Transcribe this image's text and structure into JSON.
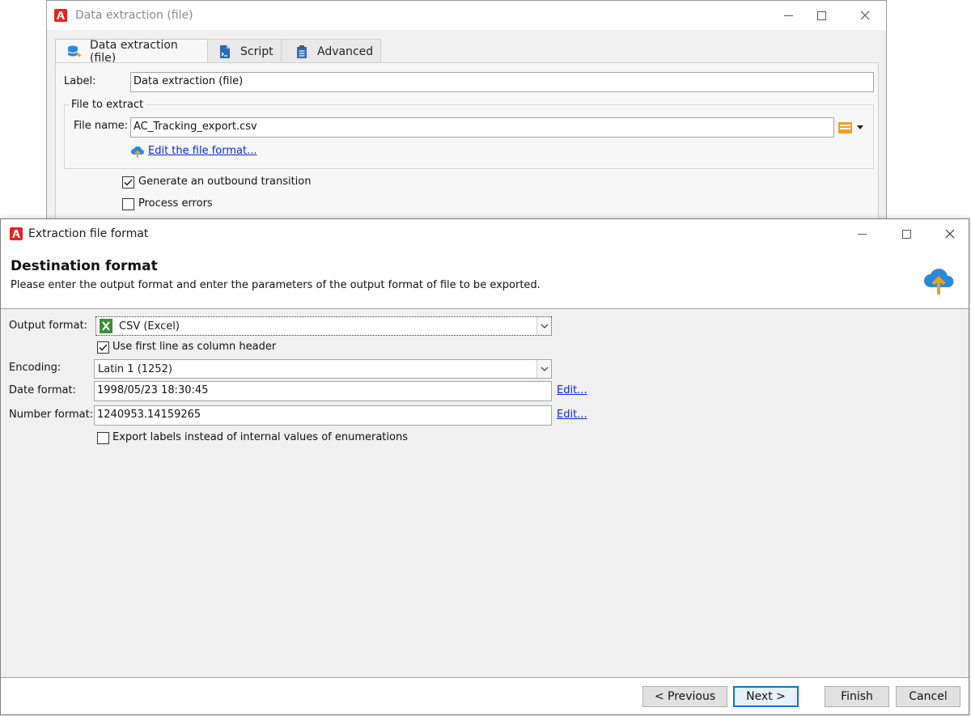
{
  "bg_window": {
    "title": "Data extraction (file)",
    "tabs": [
      {
        "label": "Data extraction (file)",
        "icon": "database-export-icon"
      },
      {
        "label": "Script",
        "icon": "script-file-icon"
      },
      {
        "label": "Advanced",
        "icon": "clipboard-settings-icon"
      }
    ],
    "label_caption": "Label:",
    "label_value": "Data extraction (file)",
    "group_title": "File to extract",
    "file_name_caption": "File name:",
    "file_name_value": "AC_Tracking_export.csv",
    "edit_format_link": "Edit the file format...",
    "generate_transition": {
      "label": "Generate an outbound transition",
      "checked": true
    },
    "process_errors": {
      "label": "Process errors",
      "checked": false
    }
  },
  "dialog": {
    "title": "Extraction file format",
    "header_title": "Destination format",
    "header_desc": "Please enter the output format and enter the parameters of the output format of file to be exported.",
    "output_format": {
      "caption": "Output format:",
      "value": "CSV (Excel)",
      "icon": "excel-icon"
    },
    "first_line_header": {
      "label": "Use first line as column header",
      "checked": true
    },
    "encoding": {
      "caption": "Encoding:",
      "value": "Latin 1 (1252)"
    },
    "date_format": {
      "caption": "Date format:",
      "value": "1998/05/23 18:30:45",
      "edit": "Edit..."
    },
    "number_format": {
      "caption": "Number format:",
      "value": "1240953.14159265",
      "edit": "Edit..."
    },
    "export_labels": {
      "label": "Export labels instead of internal values of enumerations",
      "checked": false
    },
    "buttons": {
      "previous": "< Previous",
      "next": "Next >",
      "finish": "Finish",
      "cancel": "Cancel"
    }
  },
  "colors": {
    "adobe_red": "#e8231f",
    "link_blue": "#0a28d6",
    "cloud_blue": "#2a8ad8",
    "upload_orange": "#f0a020",
    "dialog_body": "#f0f0f0"
  }
}
